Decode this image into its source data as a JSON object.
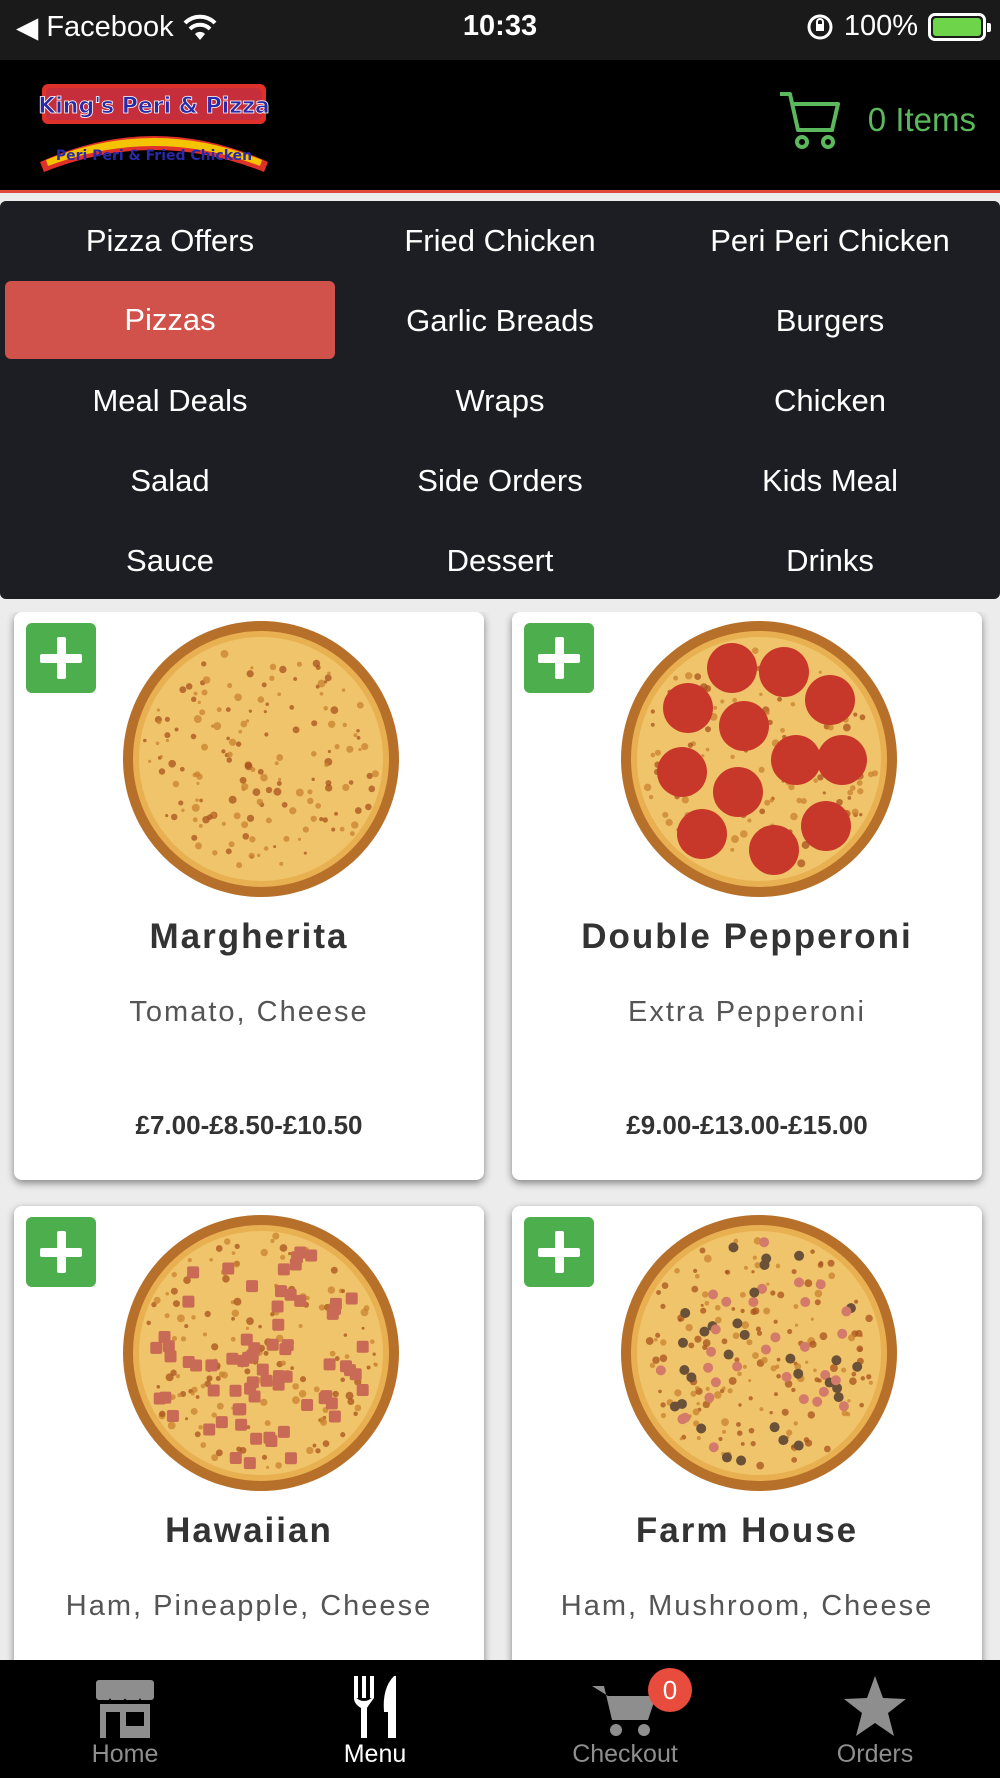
{
  "status_bar": {
    "back_app": "Facebook",
    "time": "10:33",
    "battery": "100%"
  },
  "header": {
    "logo_line1": "King's Peri & Pizza",
    "logo_line2": "Peri Peri & Fried Chicken",
    "cart_label": "0 Items"
  },
  "menu": {
    "items": [
      {
        "label": "Pizza Offers"
      },
      {
        "label": "Fried Chicken"
      },
      {
        "label": "Peri Peri Chicken"
      },
      {
        "label": "Pizzas"
      },
      {
        "label": "Garlic Breads"
      },
      {
        "label": "Burgers"
      },
      {
        "label": "Meal Deals"
      },
      {
        "label": "Wraps"
      },
      {
        "label": "Chicken"
      },
      {
        "label": "Salad"
      },
      {
        "label": "Side Orders"
      },
      {
        "label": "Kids Meal"
      },
      {
        "label": "Sauce"
      },
      {
        "label": "Dessert"
      },
      {
        "label": "Drinks"
      }
    ],
    "active": "Pizzas"
  },
  "products": [
    {
      "name": "Margherita",
      "description": "Tomato, Cheese",
      "price": "£7.00-£8.50-£10.50"
    },
    {
      "name": "Double Pepperoni",
      "description": "Extra Pepperoni",
      "price": "£9.00-£13.00-£15.00"
    },
    {
      "name": "Hawaiian",
      "description": "Ham, Pineapple, Cheese",
      "price": ""
    },
    {
      "name": "Farm House",
      "description": "Ham, Mushroom, Cheese",
      "price": ""
    }
  ],
  "tabbar": {
    "tabs": [
      {
        "label": "Home",
        "icon": "store-icon"
      },
      {
        "label": "Menu",
        "icon": "fork-knife-icon"
      },
      {
        "label": "Checkout",
        "icon": "cart-icon",
        "badge": "0"
      },
      {
        "label": "Orders",
        "icon": "star-icon"
      }
    ],
    "active": "Menu"
  },
  "colors": {
    "accent_red": "#d0524a",
    "add_green": "#4cae4c",
    "cart_green": "#5cb85c"
  }
}
